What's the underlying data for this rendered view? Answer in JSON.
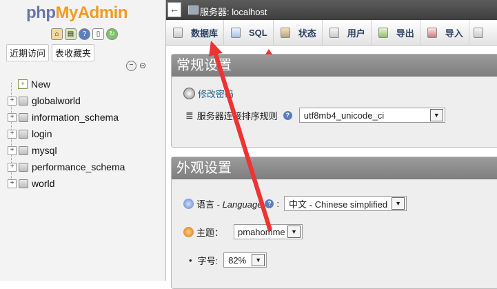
{
  "nav": {
    "logo_php": "php",
    "logo_myadmin": "MyAdmin",
    "icons": [
      "home-icon",
      "sql-query-icon",
      "help-icon",
      "docs-icon",
      "reload-icon"
    ],
    "tabs": [
      "近期访问",
      "表收藏夹"
    ],
    "new_label": "New",
    "databases": [
      "globalworld",
      "information_schema",
      "login",
      "mysql",
      "performance_schema",
      "world"
    ]
  },
  "topbar": {
    "back_glyph": "←",
    "server_label": "服务器: localhost"
  },
  "tabs": [
    {
      "label": "数据库",
      "icon": "database-icon"
    },
    {
      "label": "SQL",
      "icon": "sql-icon"
    },
    {
      "label": "状态",
      "icon": "status-icon"
    },
    {
      "label": "用户",
      "icon": "users-icon"
    },
    {
      "label": "导出",
      "icon": "export-icon"
    },
    {
      "label": "导入",
      "icon": "import-icon"
    }
  ],
  "general": {
    "title": "常规设置",
    "change_password": "修改密码",
    "collation_label": "服务器连接排序规则",
    "collation_value": "utf8mb4_unicode_ci"
  },
  "appearance": {
    "title": "外观设置",
    "language_label": "语言",
    "language_sep": " - ",
    "language_en": "Language",
    "language_value": "中文 - Chinese simplified",
    "theme_label": "主题：",
    "theme_value": "pmahomme",
    "fontsize_label": "字号:",
    "fontsize_value": "82%"
  },
  "colors": {
    "annotation": "#ee3333",
    "tab_text": "#2b3f66",
    "logo_php": "#6b75a8",
    "logo_myadmin": "#f29b1e"
  }
}
